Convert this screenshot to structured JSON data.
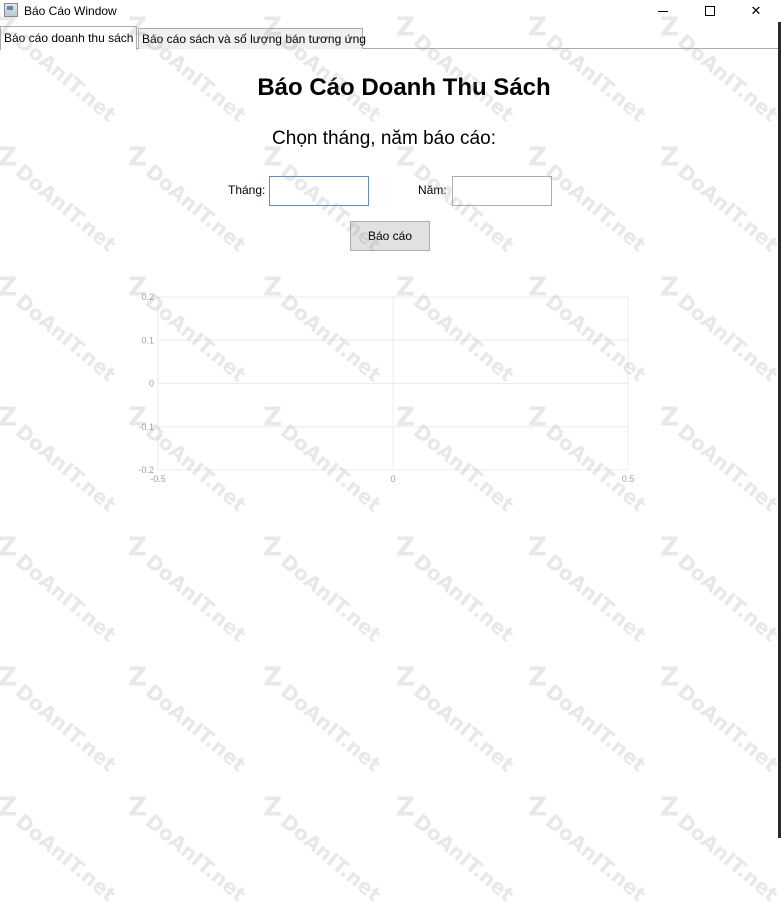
{
  "window": {
    "title": "Báo Cáo Window",
    "minimize_label": "",
    "maximize_label": "",
    "close_label": "✕"
  },
  "tabs": [
    {
      "label": "Báo cáo doanh thu sách",
      "active": true
    },
    {
      "label": "Báo cáo sách và số lượng bán tương ứng",
      "active": false
    }
  ],
  "main": {
    "title": "Báo Cáo Doanh Thu Sách",
    "subtitle": "Chọn tháng, năm báo cáo:",
    "month_label": "Tháng:",
    "month_value": "",
    "year_label": "Năm:",
    "year_value": "",
    "report_button": "Báo cáo"
  },
  "chart_data": {
    "type": "line",
    "series": [],
    "xlim": [
      -0.5,
      0.5
    ],
    "ylim": [
      -0.2,
      0.2
    ],
    "x_ticks": [
      "-0.5",
      "0",
      "0.5"
    ],
    "y_ticks": [
      "0.2",
      "0.1",
      "0",
      "-0.1",
      "-0.2"
    ],
    "grid": true
  },
  "watermark": {
    "text": "DoAnIT.net",
    "color": "#969696"
  }
}
